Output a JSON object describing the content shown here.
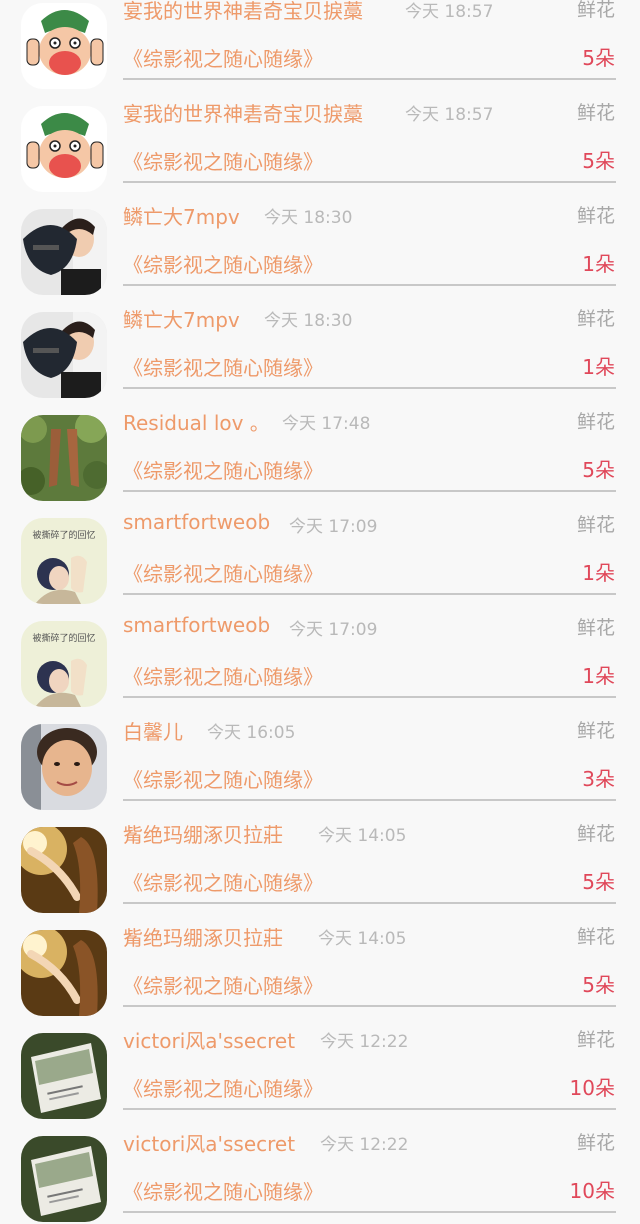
{
  "items": [
    {
      "name": "宴我的世界神砉奇宝贝捩藁",
      "time": "今天 18:57",
      "gift": "鲜花",
      "book": "《综影视之随心随缘》",
      "count": "5朵",
      "avatar_icon": "cartoon-avatar-icon"
    },
    {
      "name": "宴我的世界神砉奇宝贝捩藁",
      "time": "今天 18:57",
      "gift": "鲜花",
      "book": "《综影视之随心随缘》",
      "count": "5朵",
      "avatar_icon": "cartoon-avatar-icon"
    },
    {
      "name": "鳞亡大7mpv",
      "time": "今天 18:30",
      "gift": "鲜花",
      "book": "《综影视之随心随缘》",
      "count": "1朵",
      "avatar_icon": "person-cap-avatar-icon"
    },
    {
      "name": "鳞亡大7mpv",
      "time": "今天 18:30",
      "gift": "鲜花",
      "book": "《综影视之随心随缘》",
      "count": "1朵",
      "avatar_icon": "person-cap-avatar-icon"
    },
    {
      "name": "Residual lov 。",
      "time": "今天 17:48",
      "gift": "鲜花",
      "book": "《综影视之随心随缘》",
      "count": "5朵",
      "avatar_icon": "shoes-avatar-icon"
    },
    {
      "name": "smartfortweob",
      "time": "今天 17:09",
      "gift": "鲜花",
      "book": "《综影视之随心随缘》",
      "count": "1朵",
      "avatar_icon": "girl-drawing-avatar-icon"
    },
    {
      "name": "smartfortweob",
      "time": "今天 17:09",
      "gift": "鲜花",
      "book": "《综影视之随心随缘》",
      "count": "1朵",
      "avatar_icon": "girl-drawing-avatar-icon"
    },
    {
      "name": "白馨儿",
      "time": "今天 16:05",
      "gift": "鲜花",
      "book": "《综影视之随心随缘》",
      "count": "3朵",
      "avatar_icon": "face-photo-avatar-icon"
    },
    {
      "name": "觜绝玛绷涿贝拉莊",
      "time": "今天 14:05",
      "gift": "鲜花",
      "book": "《综影视之随心随缘》",
      "count": "5朵",
      "avatar_icon": "sunlight-arm-avatar-icon"
    },
    {
      "name": "觜绝玛绷涿贝拉莊",
      "time": "今天 14:05",
      "gift": "鲜花",
      "book": "《综影视之随心随缘》",
      "count": "5朵",
      "avatar_icon": "sunlight-arm-avatar-icon"
    },
    {
      "name": "victori风a'ssecret",
      "time": "今天 12:22",
      "gift": "鲜花",
      "book": "《综影视之随心随缘》",
      "count": "10朵",
      "avatar_icon": "book-cover-avatar-icon"
    },
    {
      "name": "victori风a'ssecret",
      "time": "今天 12:22",
      "gift": "鲜花",
      "book": "《综影视之随心随缘》",
      "count": "10朵",
      "avatar_icon": "book-cover-avatar-icon"
    }
  ],
  "avatar_text": {
    "drawing_caption": "被撕碎了的回忆"
  },
  "colors": {
    "accent_orange": "#ee9a6a",
    "count_red": "#e0485a",
    "muted_gray": "#b9b9b9",
    "divider": "#c8c8c8",
    "background": "#f8f8f8"
  }
}
